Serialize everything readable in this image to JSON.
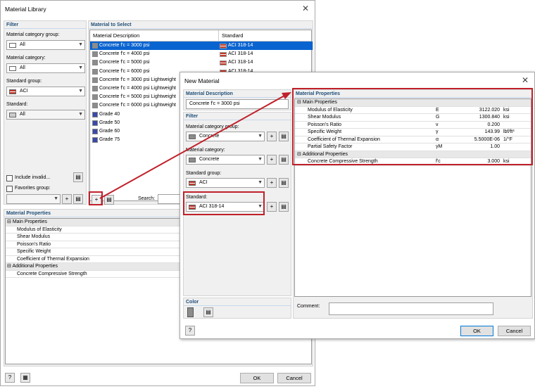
{
  "lib": {
    "title": "Material Library",
    "filter_heading": "Filter",
    "cat_group_label": "Material category group:",
    "cat_group_value": "All",
    "cat_label": "Material category:",
    "cat_value": "All",
    "std_group_label": "Standard group:",
    "std_group_value": "ACI",
    "std_label": "Standard:",
    "std_value": "All",
    "include_invalid": "Include invalid...",
    "favorites_group": "Favorites group:",
    "to_select_heading": "Material to Select",
    "col_desc": "Material Description",
    "col_std": "Standard",
    "materials": [
      {
        "name": "Concrete f'c = 3000 psi",
        "std": "ACI 318-14",
        "kind": "concrete"
      },
      {
        "name": "Concrete f'c = 4000 psi",
        "std": "ACI 318-14",
        "kind": "concrete"
      },
      {
        "name": "Concrete f'c = 5000 psi",
        "std": "ACI 318-14",
        "kind": "concrete"
      },
      {
        "name": "Concrete f'c = 6000 psi",
        "std": "ACI 318-14",
        "kind": "concrete"
      },
      {
        "name": "Concrete f'c = 3000 psi Lightweight",
        "std": "",
        "kind": "concrete"
      },
      {
        "name": "Concrete f'c = 4000 psi Lightweight",
        "std": "",
        "kind": "concrete"
      },
      {
        "name": "Concrete f'c = 5000 psi Lightweight",
        "std": "",
        "kind": "concrete"
      },
      {
        "name": "Concrete f'c = 6000 psi Lightweight",
        "std": "",
        "kind": "concrete"
      },
      {
        "name": "Grade 40",
        "std": "",
        "kind": "steel"
      },
      {
        "name": "Grade 50",
        "std": "",
        "kind": "steel"
      },
      {
        "name": "Grade 60",
        "std": "",
        "kind": "steel"
      },
      {
        "name": "Grade 75",
        "std": "",
        "kind": "steel"
      }
    ],
    "search_label": "Search:",
    "props_heading": "Material Properties",
    "props": [
      {
        "text": "Main Properties",
        "group": true
      },
      {
        "text": "Modulus of Elasticity"
      },
      {
        "text": "Shear Modulus"
      },
      {
        "text": "Poisson's Ratio"
      },
      {
        "text": "Specific Weight"
      },
      {
        "text": "Coefficient of Thermal Expansion"
      },
      {
        "text": "Additional Properties",
        "group": true
      },
      {
        "text": "Concrete Compressive Strength"
      }
    ],
    "ok": "OK",
    "cancel": "Cancel"
  },
  "newmat": {
    "title": "New Material",
    "desc_heading": "Material Description",
    "desc_value": "Concrete f'c = 3000 psi",
    "filter_heading": "Filter",
    "cat_group_label": "Material category group:",
    "cat_group_value": "Concrete",
    "cat_label": "Material category:",
    "cat_value": "Concrete",
    "std_group_label": "Standard group:",
    "std_group_value": "ACI",
    "std_label": "Standard:",
    "std_value": "ACI 318-14",
    "color_heading": "Color",
    "comment_label": "Comment:",
    "props_heading": "Material Properties",
    "props": [
      {
        "name": "Main Properties",
        "group": true
      },
      {
        "name": "Modulus of Elasticity",
        "sym": "E",
        "val": "3122.020",
        "unit": "ksi"
      },
      {
        "name": "Shear Modulus",
        "sym": "G",
        "val": "1300.840",
        "unit": "ksi"
      },
      {
        "name": "Poisson's Ratio",
        "sym": "ν",
        "val": "0.200",
        "unit": ""
      },
      {
        "name": "Specific Weight",
        "sym": "γ",
        "val": "143.99",
        "unit": "lbf/ft³"
      },
      {
        "name": "Coefficient of Thermal Expansion",
        "sym": "α",
        "val": "5.5000E-06",
        "unit": "1/°F"
      },
      {
        "name": "Partial Safety Factor",
        "sym": "γM",
        "val": "1.00",
        "unit": ""
      },
      {
        "name": "Additional Properties",
        "group": true
      },
      {
        "name": "Concrete Compressive Strength",
        "sym": "f'c",
        "val": "3.000",
        "unit": "ksi"
      }
    ],
    "ok": "OK",
    "cancel": "Cancel"
  },
  "colors": {
    "accent": "#0a64d0",
    "highlight": "#c0202a",
    "heading": "#1f4e79"
  }
}
